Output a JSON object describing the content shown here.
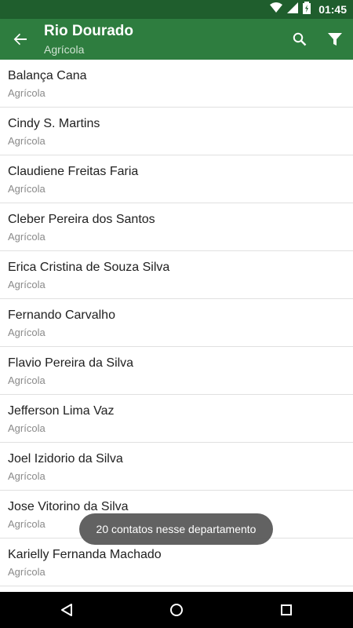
{
  "status_bar": {
    "time": "01:45",
    "icons": [
      "wifi-icon",
      "signal-icon",
      "battery-charging-icon"
    ]
  },
  "app_bar": {
    "title": "Rio Dourado",
    "subtitle": "Agrícola",
    "icons": [
      "back-arrow-icon",
      "search-icon",
      "filter-icon"
    ]
  },
  "contacts": [
    {
      "name": "Balança Cana",
      "dept": "Agrícola"
    },
    {
      "name": "Cindy S. Martins",
      "dept": "Agrícola"
    },
    {
      "name": "Claudiene Freitas Faria",
      "dept": "Agrícola"
    },
    {
      "name": "Cleber Pereira dos Santos",
      "dept": "Agrícola"
    },
    {
      "name": "Erica Cristina de Souza Silva",
      "dept": "Agrícola"
    },
    {
      "name": "Fernando Carvalho",
      "dept": "Agrícola"
    },
    {
      "name": "Flavio Pereira da Silva",
      "dept": "Agrícola"
    },
    {
      "name": "Jefferson Lima Vaz",
      "dept": "Agrícola"
    },
    {
      "name": "Joel Izidorio da Silva",
      "dept": "Agrícola"
    },
    {
      "name": "Jose Vitorino da Silva",
      "dept": "Agrícola"
    },
    {
      "name": "Karielly Fernanda Machado",
      "dept": "Agrícola"
    }
  ],
  "toast": "20 contatos nesse departamento",
  "nav_bar": {
    "icons": [
      "nav-back-icon",
      "nav-home-icon",
      "nav-recents-icon"
    ]
  },
  "colors": {
    "status_bar": "#1f5e2d",
    "app_bar": "#2e7d3f",
    "toast": "#5d5d5d"
  }
}
